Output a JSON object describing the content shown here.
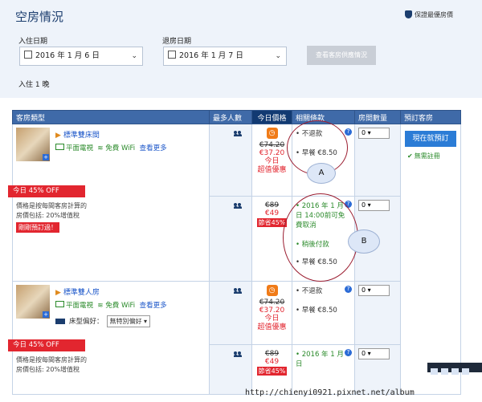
{
  "header": {
    "title": "空房情況",
    "guarantee": "保證最優房價"
  },
  "checkin": {
    "label": "入住日期",
    "value": "2016 年 1 月 6 日"
  },
  "checkout": {
    "label": "退房日期",
    "value": "2016 年 1 月 7 日"
  },
  "check_button": "查看客房供應情況",
  "stay": "入住 1 晚",
  "table_headers": {
    "room_type": "客房類型",
    "max_people": "最多人數",
    "today_price": "今日價格",
    "policy": "相關條款",
    "qty": "房間數量",
    "book": "預訂客房"
  },
  "rooms": [
    {
      "name": "標準雙床間",
      "amenities": {
        "tv": "平面電視",
        "wifi": "免費 WiFi",
        "more": "查看更多"
      },
      "deal": "今日 45% OFF",
      "note1": "價格是按每間客房計算的",
      "note2": "房價包括: 20%增值稅",
      "booked": "剛剛預訂過！",
      "offer1": {
        "old_price": "€74.20",
        "new_price": "€37.20",
        "today": "今日",
        "special": "超值優惠",
        "policy_nonrefund": "不退款",
        "policy_breakfast": "早餐 €8.50",
        "qty": "0"
      },
      "offer2": {
        "old_price": "€89",
        "new_price": "€49",
        "discount": "節省45%",
        "policy_free_cancel": "2016 年 1 月 6 日 14:00前可免費取消",
        "policy_pay_later": "稍後付款",
        "policy_breakfast": "早餐 €8.50",
        "qty": "0"
      }
    },
    {
      "name": "標準雙人房",
      "amenities": {
        "tv": "平面電視",
        "wifi": "免費 WiFi",
        "more": "查看更多"
      },
      "bed_pref": "床型偏好：",
      "bed_option": "無特別偏好",
      "deal": "今日 45% OFF",
      "note1": "價格是按每間客房計算的",
      "note2": "房價包括: 20%增值稅",
      "offer1": {
        "old_price": "€74.20",
        "new_price": "€37.20",
        "today": "今日",
        "special": "超值優惠",
        "policy_nonrefund": "不退款",
        "policy_breakfast": "早餐 €8.50",
        "qty": "0"
      },
      "offer2": {
        "old_price": "€89",
        "new_price": "€49",
        "discount": "節省45%",
        "policy_free_cancel": "2016 年 1 月 6 日",
        "qty": "0"
      }
    }
  ],
  "book_now": "現在就預訂",
  "no_register": "無需註冊",
  "annotations": {
    "a": "A",
    "b": "B"
  },
  "watermark": "http://chienyi0921.pixnet.net/album"
}
